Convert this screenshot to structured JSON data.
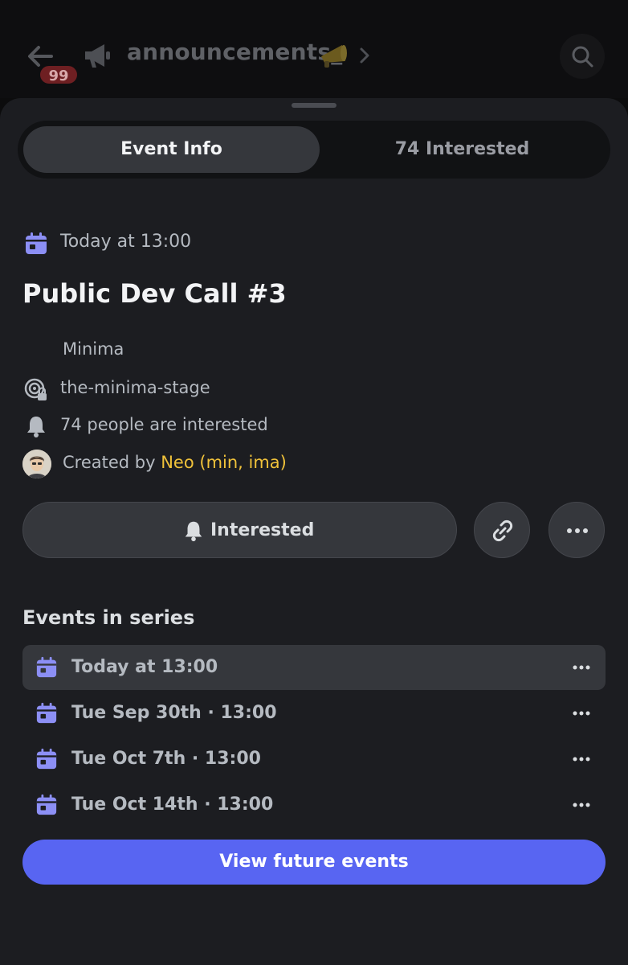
{
  "header": {
    "back_icon": "arrow-left-icon",
    "unread_badge": "99",
    "channel_icon": "megaphone-icon",
    "channel_name": "announcements_",
    "channel_emoji": "megaphone-emoji-icon",
    "search_icon": "search-icon"
  },
  "tabs": [
    {
      "label": "Event Info",
      "active": true
    },
    {
      "label": "74 Interested",
      "active": false
    }
  ],
  "event": {
    "date": "Today at 13:00",
    "title": "Public Dev Call #3",
    "server": "Minima",
    "channel": "the-minima-stage",
    "interested_count_text": "74 people are interested",
    "created_by_prefix": "Created by ",
    "creator": "Neo (min, ima)"
  },
  "actions": {
    "interested_label": "Interested",
    "copy_link_icon": "link-icon",
    "more_icon": "more-horizontal-icon"
  },
  "series": {
    "heading": "Events in series",
    "items": [
      {
        "label": "Today at 13:00",
        "active": true
      },
      {
        "label": "Tue Sep 30th · 13:00",
        "active": false
      },
      {
        "label": "Tue Oct 7th · 13:00",
        "active": false
      },
      {
        "label": "Tue Oct 14th · 13:00",
        "active": false
      }
    ]
  },
  "footer": {
    "view_future_label": "View future events"
  },
  "colors": {
    "accent": "#5865f2",
    "calendar_icon": "#8c8ff5",
    "creator_name": "#f0c23a",
    "badge": "#6e1f22"
  }
}
